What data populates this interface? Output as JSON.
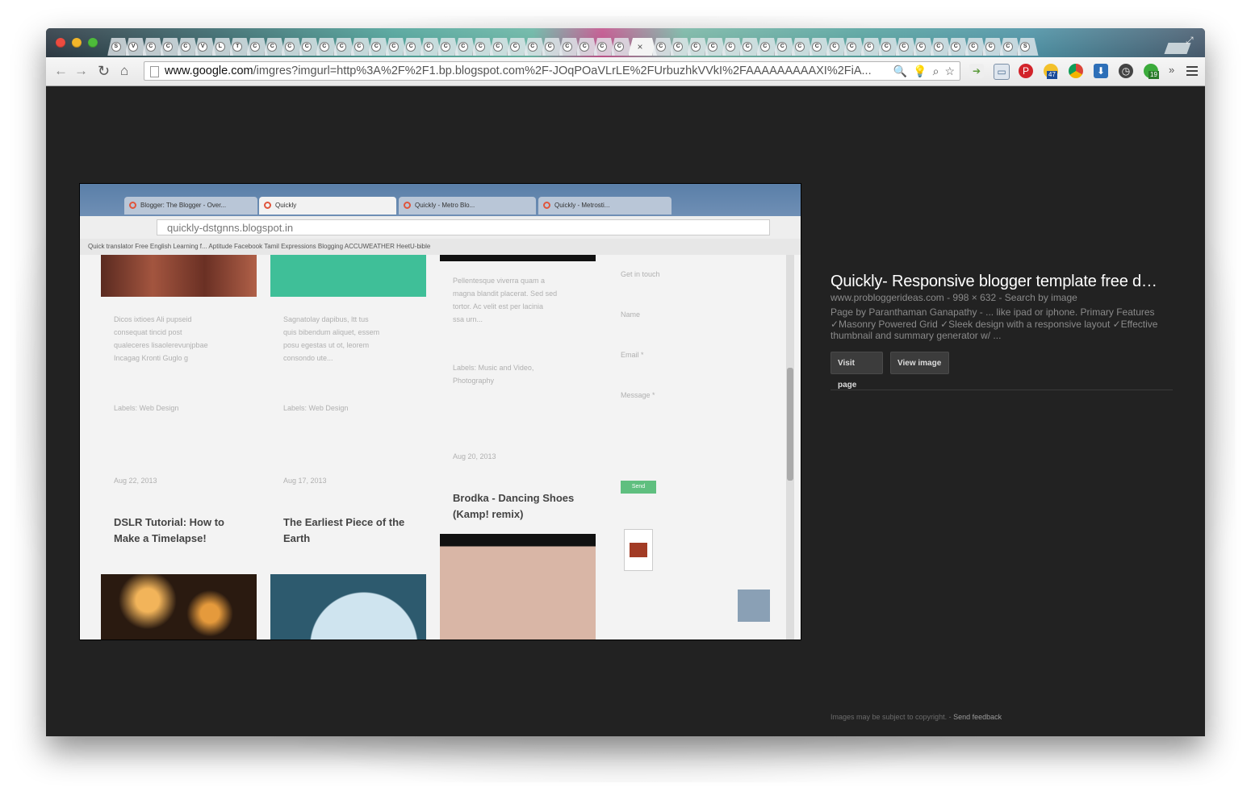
{
  "browser": {
    "tab_count": 53,
    "tab_favicon_letters": [
      "S",
      "V",
      "C",
      "C",
      "C",
      "V",
      "L",
      "T",
      "C",
      "C",
      "C",
      "C",
      "C",
      "C",
      "C",
      "C",
      "C",
      "C",
      "C",
      "C",
      "C",
      "C",
      "C",
      "C",
      "C",
      "C",
      "C",
      "C",
      "C",
      "C",
      "C",
      "C",
      "C",
      "C",
      "C",
      "C",
      "C",
      "C",
      "C",
      "C",
      "C",
      "C",
      "C",
      "C",
      "C",
      "C",
      "C",
      "C",
      "C",
      "C",
      "C",
      "C",
      "S"
    ],
    "active_tab_index": 30,
    "address_bar": {
      "domain": "www.google.com",
      "path": "/imgres?imgurl=http%3A%2F%2F1.bp.blogspot.com%2F-JOqPOaVLrLE%2FUrbuzhkVVkI%2FAAAAAAAAAXI%2FiA..."
    },
    "extensions": [
      "rss-icon",
      "window-icon",
      "pinterest-icon",
      "weather-icon",
      "chrome-icon",
      "download-icon",
      "clock-icon",
      "evernote-icon"
    ],
    "weather_badge": "47",
    "evernote_badge": "19"
  },
  "result": {
    "title": "Quickly- Responsive blogger template free d…",
    "meta": "www.probloggerideas.com - 998 × 632 - Search by image",
    "description": "Page by Paranthaman Ganapathy - ... like ipad or iphone. Primary Features ✓Masonry Powered Grid ✓Sleek design with a responsive layout ✓Effective thumbnail and summary generator w/ ...",
    "visit_label": "Visit page",
    "view_label": "View image"
  },
  "footer": {
    "copyright": "Images may be subject to copyright.",
    "separator": " - ",
    "feedback": "Send feedback"
  },
  "preview": {
    "tabs": [
      "Blogger: The Blogger - Over...",
      "Quickly",
      "Quickly - Metro Blo...",
      "Quickly - Metrosti..."
    ],
    "url": "quickly-dstgnns.blogspot.in",
    "bookmarks": "Quick translator   Free English Learning f...   Aptitude   Facebook   Tamil Expressions   Blogging   ACCUWEATHER   HeetU-bible",
    "posts": [
      {
        "heading": "DSLR Tutorial: How to Make a Timelapse!",
        "date": "Aug 22, 2013"
      },
      {
        "heading": "The Earliest Piece of the Earth",
        "date": "Aug 17, 2013"
      },
      {
        "heading": "Brodka - Dancing Shoes (Kamp! remix)",
        "date": "Aug 20, 2013"
      }
    ],
    "form_labels": [
      "Get in touch",
      "Name",
      "Email *",
      "Message *"
    ],
    "send_label": "Send"
  },
  "colors": {
    "page_bg": "#222222",
    "title": "#ffffff",
    "meta": "#8a8a8a",
    "button_bg": "#3c3c3c"
  }
}
